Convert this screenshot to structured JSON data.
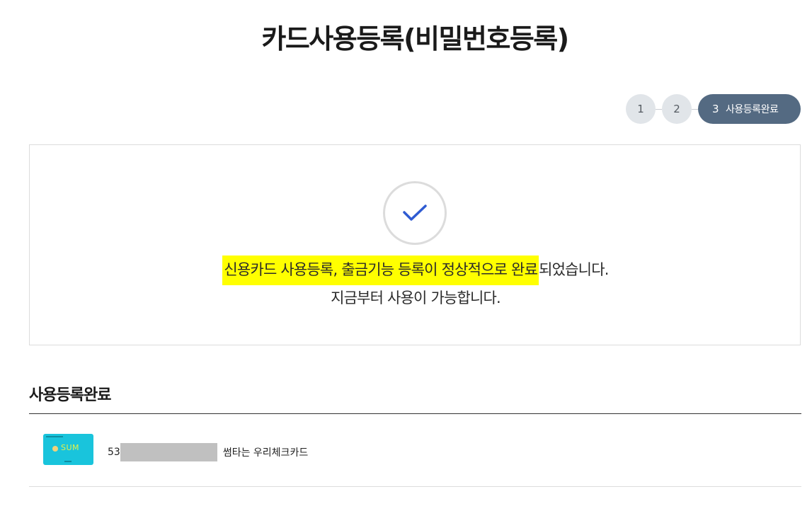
{
  "page": {
    "title": "카드사용등록(비밀번호등록)"
  },
  "steps": {
    "step1": "1",
    "step2": "2",
    "step3_num": "3",
    "step3_label": "사용등록완료"
  },
  "result": {
    "message_highlight": "신용카드 사용등록, 출금기능 등록이 정상적으로 완료",
    "message_rest": "되었습니다.",
    "message_line2": "지금부터 사용이 가능합니다."
  },
  "section": {
    "title": "사용등록완료"
  },
  "card": {
    "number_prefix": "53",
    "name": "썸타는 우리체크카드",
    "image_brand": "SUM"
  },
  "colors": {
    "highlight": "#ffff00",
    "step_active": "#546a82",
    "check": "#2f5bd2",
    "card": "#19c4dc"
  }
}
